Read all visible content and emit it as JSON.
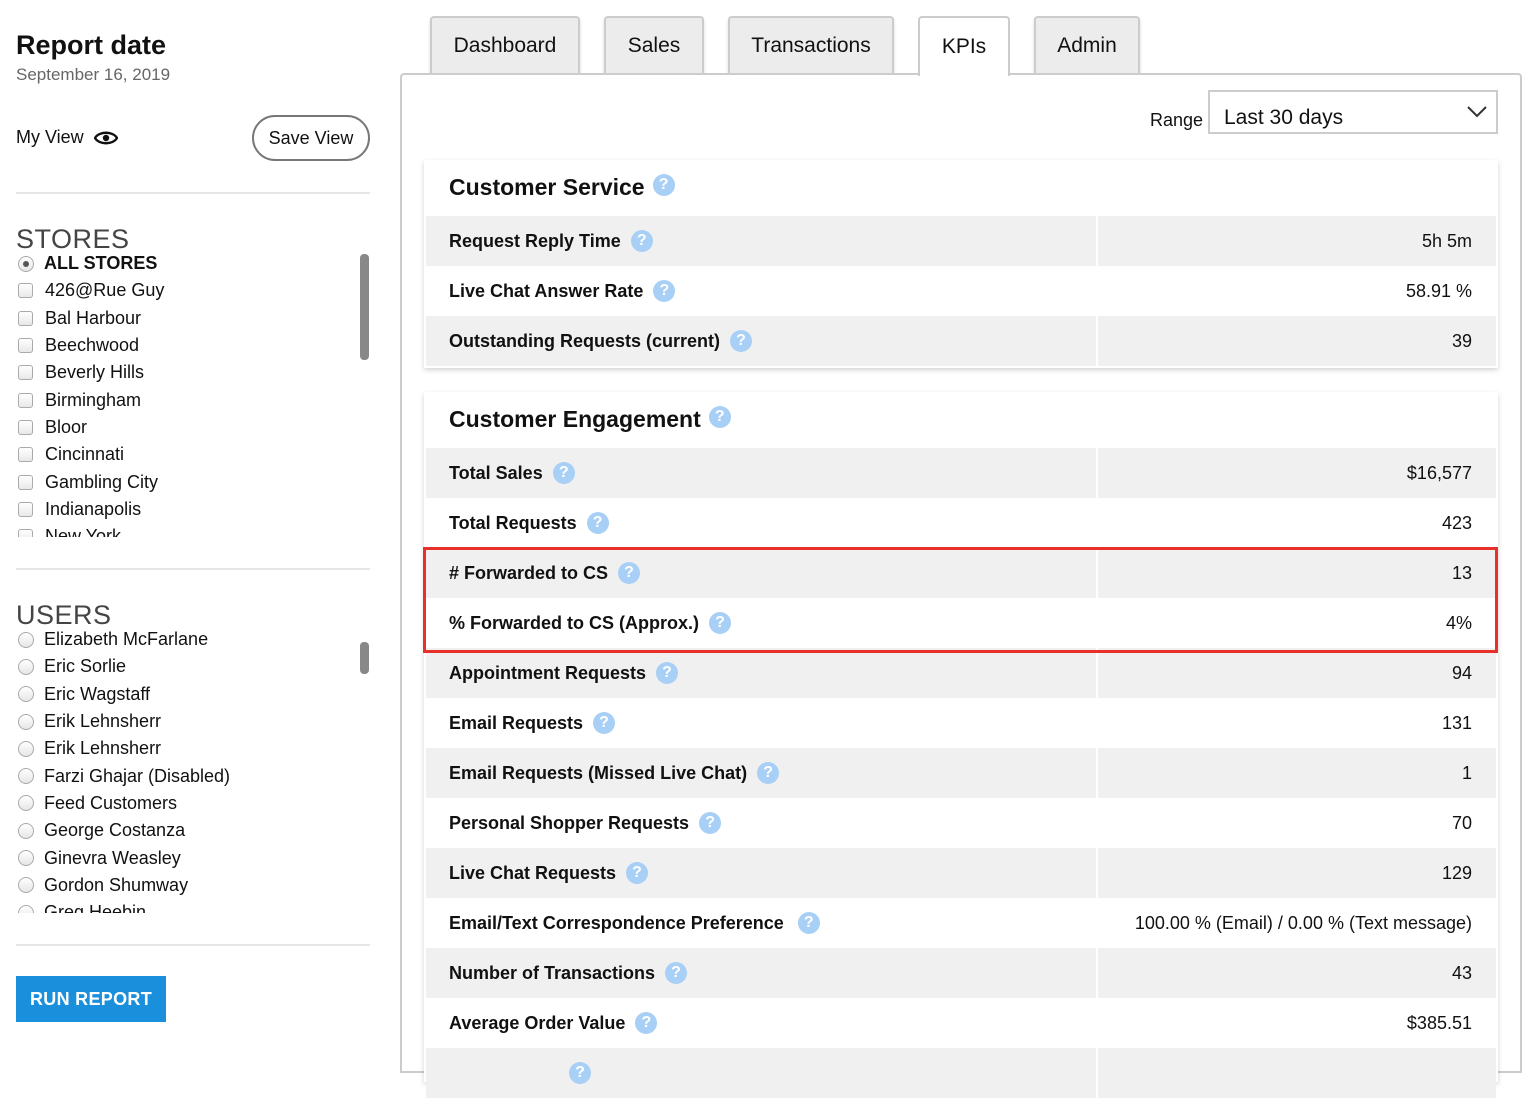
{
  "sidebar": {
    "report_title": "Report date",
    "report_date": "September 16, 2019",
    "my_view": "My View",
    "save_view": "Save View",
    "stores_title": "STORES",
    "stores": [
      "ALL STORES",
      "426@Rue Guy",
      "Bal Harbour",
      "Beechwood",
      "Beverly Hills",
      "Birmingham",
      "Bloor",
      "Cincinnati",
      "Gambling City",
      "Indianapolis",
      "New York"
    ],
    "users_title": "USERS",
    "users": [
      "Elizabeth McFarlane",
      "Eric Sorlie",
      "Eric Wagstaff",
      "Erik Lehnsherr",
      "Erik Lehnsherr",
      "Farzi Ghajar (Disabled)",
      "Feed Customers",
      "George Costanza",
      "Ginevra Weasley",
      "Gordon Shumway",
      "Greg Heebin"
    ],
    "run_report": "RUN REPORT"
  },
  "tabs": [
    "Dashboard",
    "Sales",
    "Transactions",
    "KPIs",
    "Admin"
  ],
  "active_tab": "KPIs",
  "range": {
    "label": "Range",
    "value": "Last 30 days"
  },
  "customer_service": {
    "title": "Customer Service",
    "rows": [
      {
        "label": "Request Reply Time",
        "value": "5h 5m"
      },
      {
        "label": "Live Chat Answer Rate",
        "value": "58.91 %"
      },
      {
        "label": "Outstanding Requests (current)",
        "value": "39"
      }
    ]
  },
  "customer_engagement": {
    "title": "Customer Engagement",
    "rows": [
      {
        "label": "Total Sales",
        "value": "$16,577"
      },
      {
        "label": "Total Requests",
        "value": "423"
      },
      {
        "label": "# Forwarded to CS",
        "value": "13"
      },
      {
        "label": "% Forwarded to CS (Approx.)",
        "value": "4%"
      },
      {
        "label": "Appointment Requests",
        "value": "94"
      },
      {
        "label": "Email Requests",
        "value": "131"
      },
      {
        "label": "Email Requests (Missed Live Chat)",
        "value": "1"
      },
      {
        "label": "Personal Shopper Requests",
        "value": "70"
      },
      {
        "label": "Live Chat Requests",
        "value": "129"
      },
      {
        "label": "Email/Text Correspondence Preference",
        "value": "100.00 % (Email) / 0.00 % (Text message)"
      },
      {
        "label": "Number of Transactions",
        "value": "43"
      },
      {
        "label": "Average Order Value",
        "value": "$385.51"
      }
    ]
  },
  "help_glyph": "?",
  "colors": {
    "accent": "#1a8fdc",
    "help": "#a8cff5",
    "highlight": "#e8302a",
    "row_shade": "#f0f0f0"
  }
}
